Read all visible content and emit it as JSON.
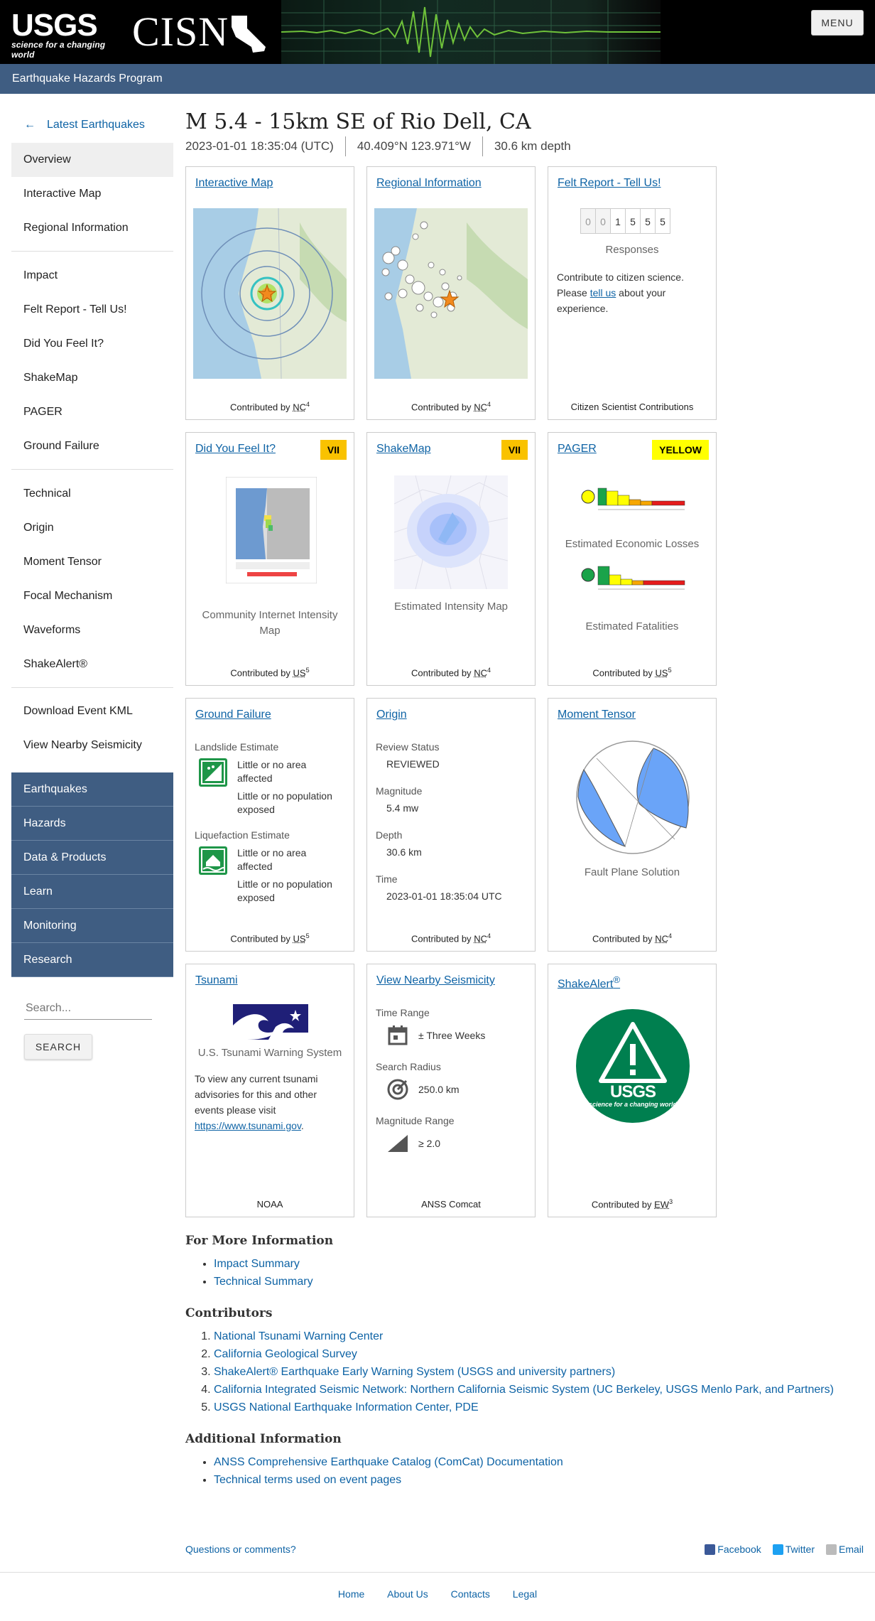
{
  "header": {
    "usgs_logo_text": "USGS",
    "usgs_tagline": "science for a changing world",
    "cisn_logo_text": "CISN",
    "menu_label": "MENU"
  },
  "program_bar": "Earthquake Hazards Program",
  "sidebar": {
    "back_label": "Latest Earthquakes",
    "groups": [
      [
        "Overview",
        "Interactive Map",
        "Regional Information"
      ],
      [
        "Impact",
        "Felt Report - Tell Us!",
        "Did You Feel It?",
        "ShakeMap",
        "PAGER",
        "Ground Failure"
      ],
      [
        "Technical",
        "Origin",
        "Moment Tensor",
        "Focal Mechanism",
        "Waveforms",
        "ShakeAlert®"
      ],
      [
        "Download Event KML",
        "View Nearby Seismicity"
      ]
    ],
    "site_nav": [
      "Earthquakes",
      "Hazards",
      "Data & Products",
      "Learn",
      "Monitoring",
      "Research"
    ],
    "search_placeholder": "Search...",
    "search_button": "SEARCH"
  },
  "event": {
    "title": "M 5.4 - 15km SE of Rio Dell, CA",
    "time": "2023-01-01 18:35:04 (UTC)",
    "location": "40.409°N 123.971°W",
    "depth": "30.6 km depth"
  },
  "cards": {
    "interactive_map": {
      "title": "Interactive Map",
      "contrib": "Contributed by",
      "network": "NC",
      "ref": "4"
    },
    "regional": {
      "title": "Regional Information",
      "contrib": "Contributed by",
      "network": "NC",
      "ref": "4"
    },
    "felt_report": {
      "title": "Felt Report - Tell Us!",
      "digits": [
        "0",
        "0",
        "1",
        "5",
        "5",
        "5"
      ],
      "responses_label": "Responses",
      "text_pre": "Contribute to citizen science. Please ",
      "link": "tell us",
      "text_post": " about your experience.",
      "footer": "Citizen Scientist Contributions"
    },
    "dyfi": {
      "title": "Did You Feel It?",
      "badge": "VII",
      "caption": "Community Internet Intensity Map",
      "contrib": "Contributed by",
      "network": "US",
      "ref": "5"
    },
    "shakemap": {
      "title": "ShakeMap",
      "badge": "VII",
      "caption": "Estimated Intensity Map",
      "contrib": "Contributed by",
      "network": "NC",
      "ref": "4"
    },
    "pager": {
      "title": "PAGER",
      "badge": "YELLOW",
      "losses_caption": "Estimated Economic Losses",
      "fatalities_caption": "Estimated Fatalities",
      "contrib": "Contributed by",
      "network": "US",
      "ref": "5"
    },
    "ground_failure": {
      "title": "Ground Failure",
      "landslide_label": "Landslide Estimate",
      "landslide_area": "Little or no area affected",
      "landslide_pop": "Little or no population exposed",
      "liquefaction_label": "Liquefaction Estimate",
      "liquefaction_area": "Little or no area affected",
      "liquefaction_pop": "Little or no population exposed",
      "contrib": "Contributed by",
      "network": "US",
      "ref": "5"
    },
    "origin": {
      "title": "Origin",
      "review_label": "Review Status",
      "review_value": "REVIEWED",
      "mag_label": "Magnitude",
      "mag_value": "5.4 mw",
      "depth_label": "Depth",
      "depth_value": "30.6 km",
      "time_label": "Time",
      "time_value": "2023-01-01 18:35:04 UTC",
      "contrib": "Contributed by",
      "network": "NC",
      "ref": "4"
    },
    "moment_tensor": {
      "title": "Moment Tensor",
      "caption": "Fault Plane Solution",
      "contrib": "Contributed by",
      "network": "NC",
      "ref": "4"
    },
    "tsunami": {
      "title": "Tsunami",
      "caption": "U.S. Tsunami Warning System",
      "text": "To view any current tsunami advisories for this and other events please visit",
      "link": "https://www.tsunami.gov",
      "footer": "NOAA"
    },
    "nearby": {
      "title": "View Nearby Seismicity",
      "time_label": "Time Range",
      "time_value": "± Three Weeks",
      "radius_label": "Search Radius",
      "radius_value": "250.0 km",
      "mag_label": "Magnitude Range",
      "mag_value": "≥ 2.0",
      "footer": "ANSS Comcat"
    },
    "shakealert": {
      "title": "ShakeAlert",
      "title_sup": "®",
      "logo_text": "USGS",
      "logo_tagline": "science for a changing world",
      "contrib": "Contributed by",
      "network": "EW",
      "ref": "3"
    }
  },
  "more_info": {
    "title": "For More Information",
    "links": [
      "Impact Summary",
      "Technical Summary"
    ]
  },
  "contributors": {
    "title": "Contributors",
    "links": [
      "National Tsunami Warning Center",
      "California Geological Survey",
      "ShakeAlert® Earthquake Early Warning System (USGS and university partners)",
      "California Integrated Seismic Network: Northern California Seismic System (UC Berkeley, USGS Menlo Park, and Partners)",
      "USGS National Earthquake Information Center, PDE"
    ]
  },
  "additional": {
    "title": "Additional Information",
    "links": [
      "ANSS Comprehensive Earthquake Catalog (ComCat) Documentation",
      "Technical terms used on event pages"
    ]
  },
  "bottom": {
    "questions": "Questions or comments?",
    "facebook": "Facebook",
    "twitter": "Twitter",
    "email": "Email"
  },
  "footer_links": [
    "Home",
    "About Us",
    "Contacts",
    "Legal"
  ],
  "colors": {
    "navy": "#3f5d82",
    "link": "#0e63a5",
    "orange_badge": "#f9c200",
    "yellow_badge": "#ffff00",
    "shakealert_green": "#007f4f"
  }
}
